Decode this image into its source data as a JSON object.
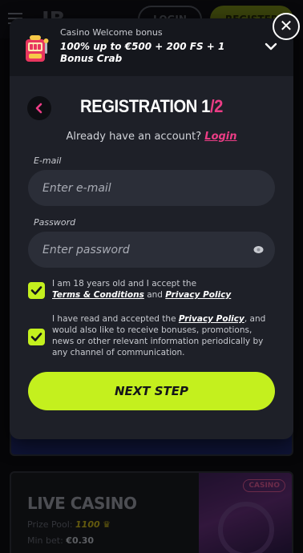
{
  "background": {
    "logo": "IB",
    "login_label": "LOGIN",
    "register_label": "REGISTER",
    "card": {
      "badge": "CASINO",
      "title": "LIVE CASINO",
      "prize_pool_label": "Prize Pool:",
      "prize_pool_value": "1100",
      "min_bet_label": "Min bet:",
      "min_bet_value": "€0.30"
    }
  },
  "bonus": {
    "label": "Casino Welcome bonus",
    "text": "100% up to €500 + 200 FS + 1 Bonus Crab",
    "icon": "slot-machine-icon"
  },
  "close_label": "✕",
  "registration": {
    "title_prefix": "REGISTRATION 1",
    "title_separator": "/",
    "title_total": "2",
    "have_account_text": "Already have an account?",
    "login_link": "Login"
  },
  "form": {
    "email_label": "E-mail",
    "email_placeholder": "Enter e-mail",
    "email_value": "",
    "password_label": "Password",
    "password_placeholder": "Enter password",
    "password_value": ""
  },
  "consents": {
    "age": {
      "checked": true,
      "text_before": "I am 18 years old and I accept the",
      "link1": "Terms & Conditions",
      "middle": "and",
      "link2": "Privacy Policy"
    },
    "marketing": {
      "checked": true,
      "text_before": "I have read and accepted the",
      "link": "Privacy Policy",
      "text_after": ", and would also like to receive bonuses, promotions, news or other relevant information periodically by any channel of communication."
    }
  },
  "next_button_label": "NEXT STEP",
  "colors": {
    "accent_green": "#c4f01e",
    "accent_pink": "#ec3d86",
    "modal_bg": "#1e2028",
    "input_bg": "#2b2e38"
  }
}
